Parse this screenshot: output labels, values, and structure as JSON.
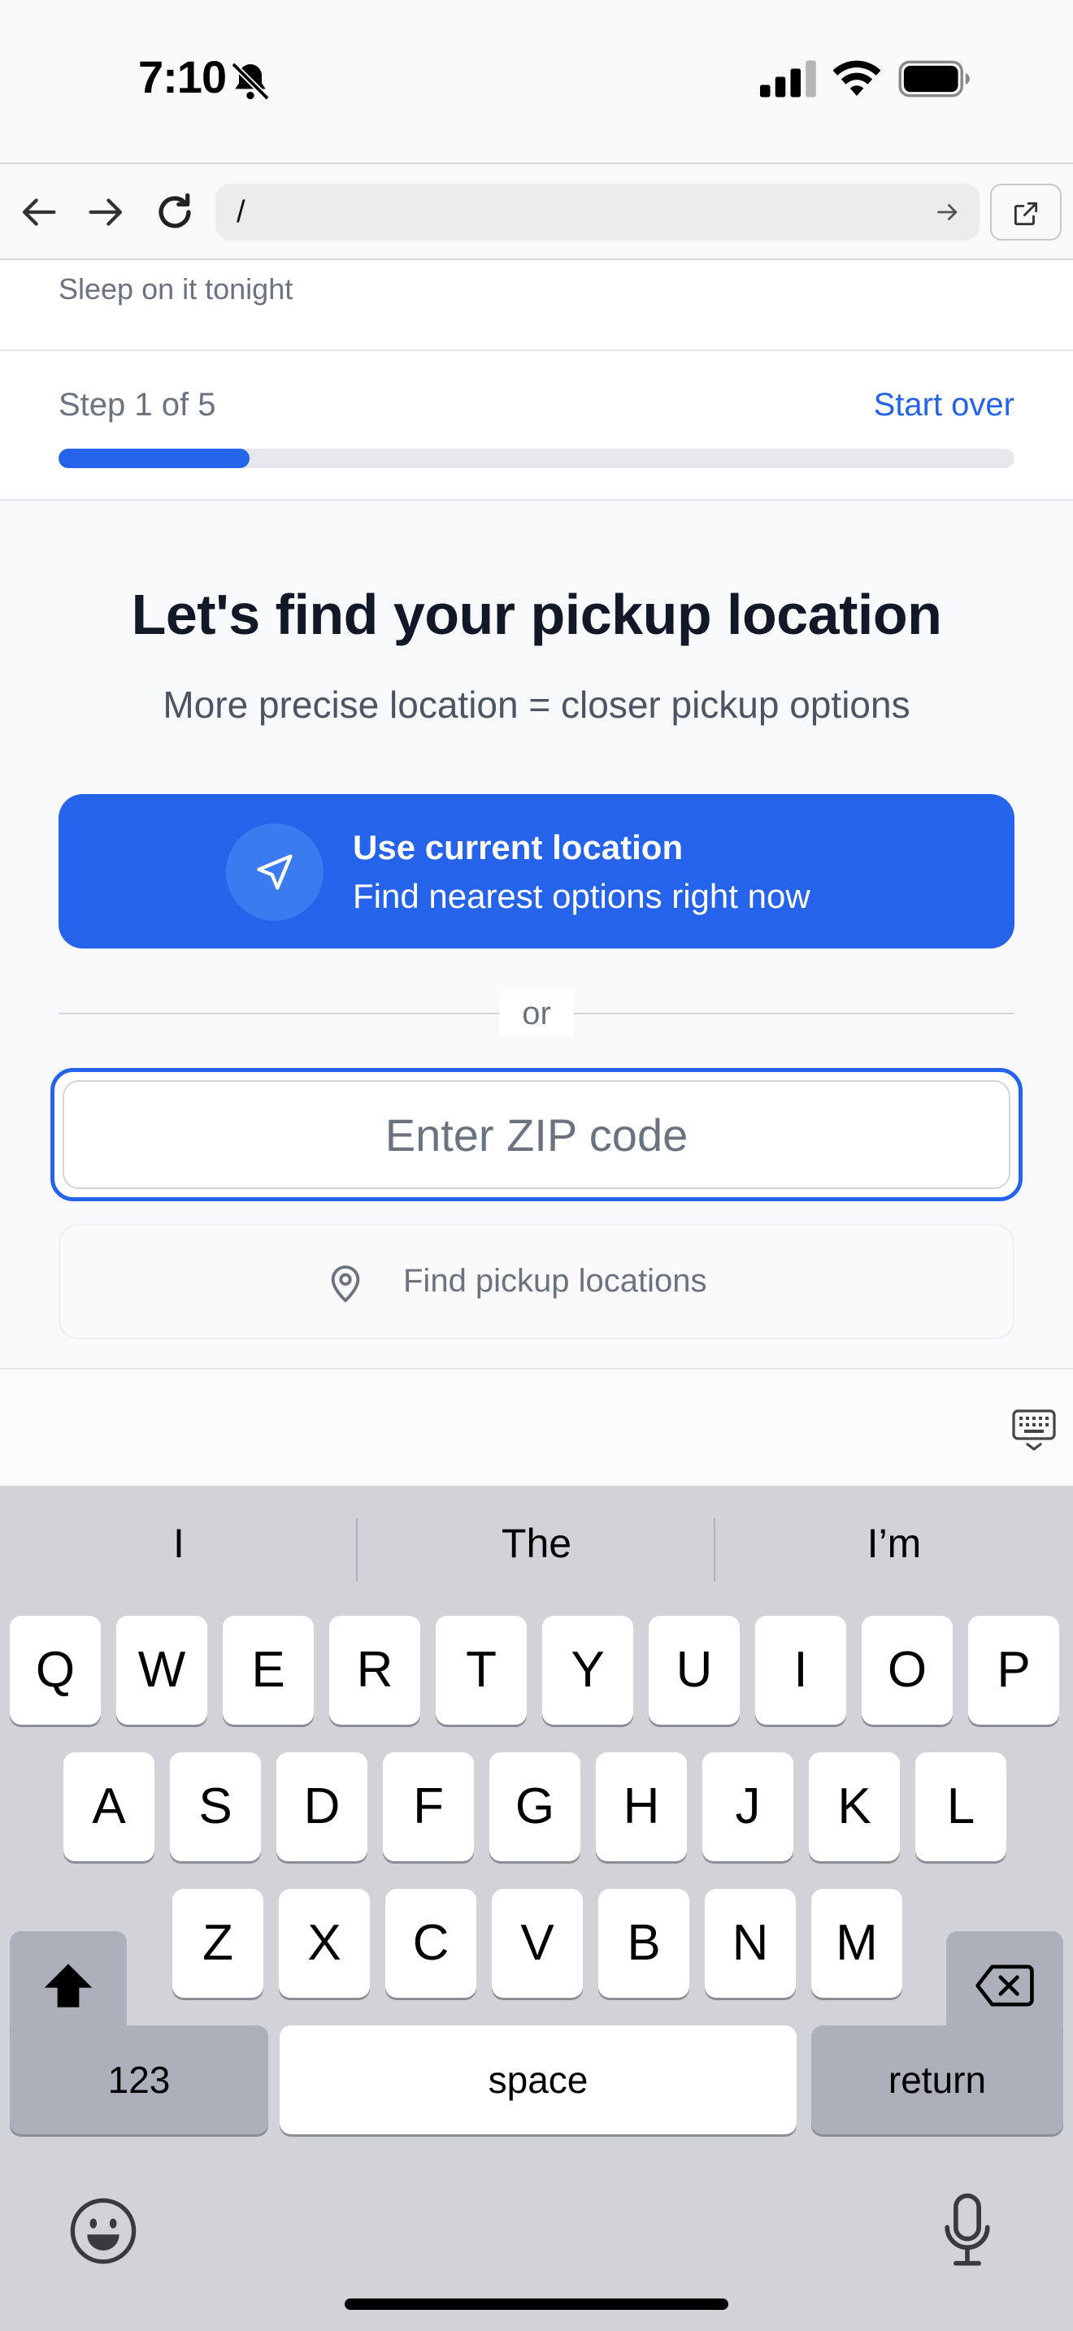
{
  "status_bar": {
    "time": "7:10"
  },
  "browser": {
    "url": "/"
  },
  "page": {
    "top_note": "Sleep on it tonight",
    "step": {
      "label": "Step 1 of 5",
      "start_over": "Start over",
      "progress_fraction": 0.2
    },
    "headline": "Let's find your pickup location",
    "subline": "More precise location = closer pickup options",
    "use_location": {
      "title": "Use current location",
      "subtitle": "Find nearest options right now"
    },
    "divider_text": "or",
    "zip": {
      "placeholder": "Enter ZIP code",
      "value": ""
    },
    "find_button": "Find pickup locations",
    "colors": {
      "accent": "#2563eb",
      "page_bg": "#f8f9fb",
      "muted_text": "#6b7280"
    }
  },
  "keyboard": {
    "suggestions": [
      "I",
      "The",
      "I’m"
    ],
    "row1": [
      "Q",
      "W",
      "E",
      "R",
      "T",
      "Y",
      "U",
      "I",
      "O",
      "P"
    ],
    "row2": [
      "A",
      "S",
      "D",
      "F",
      "G",
      "H",
      "J",
      "K",
      "L"
    ],
    "row3": [
      "Z",
      "X",
      "C",
      "V",
      "B",
      "N",
      "M"
    ],
    "numbers_key": "123",
    "space_key": "space",
    "return_key": "return",
    "icons": [
      "shift-icon",
      "backspace-icon",
      "emoji-icon",
      "microphone-icon",
      "keyboard-dismiss-icon"
    ]
  }
}
